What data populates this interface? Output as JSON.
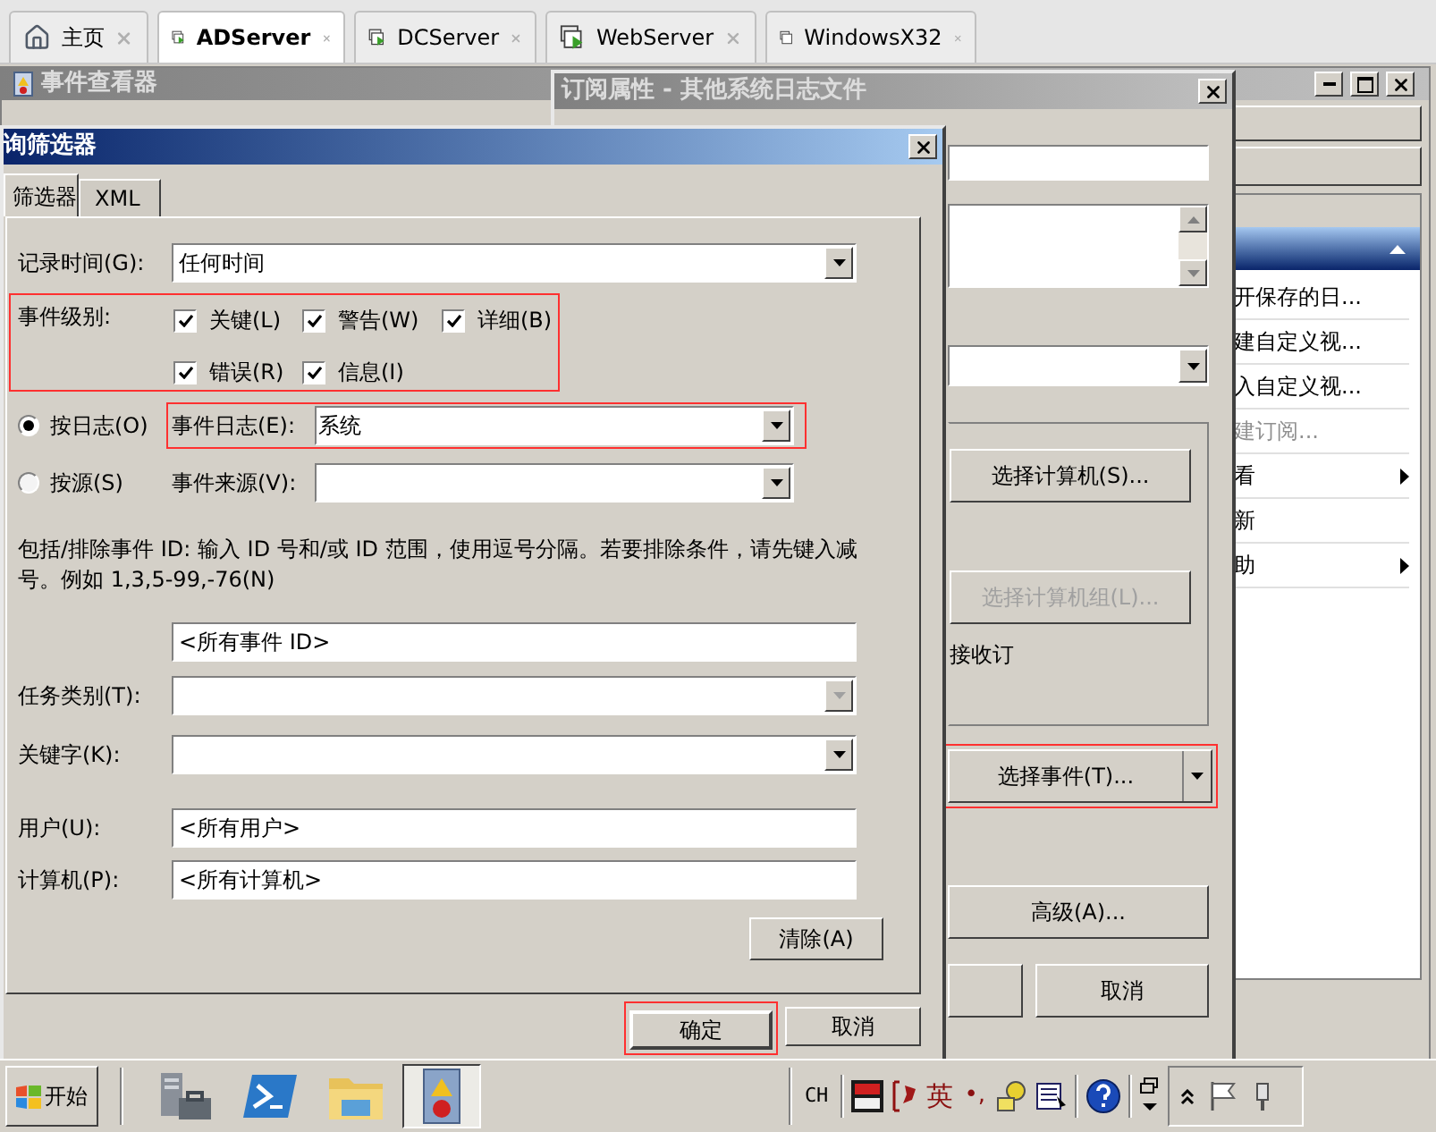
{
  "browser_tabs": [
    {
      "label": "主页",
      "kind": "home",
      "selected": false
    },
    {
      "label": "ADServer",
      "kind": "running",
      "selected": true
    },
    {
      "label": "DCServer",
      "kind": "running",
      "selected": false
    },
    {
      "label": "WebServer",
      "kind": "running",
      "selected": false
    },
    {
      "label": "WindowsX32",
      "kind": "stopped",
      "selected": false
    }
  ],
  "event_viewer": {
    "title": "事件查看器",
    "actions": [
      {
        "label": "开保存的日...",
        "disabled": false,
        "submenu": false
      },
      {
        "label": "建自定义视...",
        "disabled": false,
        "submenu": false
      },
      {
        "label": "入自定义视...",
        "disabled": false,
        "submenu": false
      },
      {
        "label": "建订阅...",
        "disabled": true,
        "submenu": false
      },
      {
        "label": "看",
        "disabled": false,
        "submenu": true
      },
      {
        "label": "新",
        "disabled": false,
        "submenu": false
      },
      {
        "label": "助",
        "disabled": false,
        "submenu": true
      }
    ]
  },
  "subscription_dialog": {
    "title": "订阅属性 - 其他系统日志文件",
    "select_computers_button": {
      "label": "选择计算机(S)...",
      "disabled": false
    },
    "select_group_button": {
      "label": "选择计算机组(L)...",
      "disabled": true
    },
    "receive_text": "接收订",
    "select_events_button": {
      "label": "选择事件(T)...",
      "highlighted": true
    },
    "advanced_button": "高级(A)...",
    "cancel_button": "取消"
  },
  "filter_dialog": {
    "title": "询筛选器",
    "tabs": [
      {
        "label": "筛选器",
        "selected": true
      },
      {
        "label": "XML",
        "selected": false
      }
    ],
    "logged": {
      "label": "记录时间(G):",
      "value": "任何时间"
    },
    "event_level": {
      "label": "事件级别:",
      "highlighted": true,
      "levels": [
        {
          "label": "关键(L)",
          "checked": true
        },
        {
          "label": "警告(W)",
          "checked": true
        },
        {
          "label": "详细(B)",
          "checked": true
        },
        {
          "label": "错误(R)",
          "checked": true
        },
        {
          "label": "信息(I)",
          "checked": true
        }
      ]
    },
    "scope": [
      {
        "label": "按日志(O)",
        "selected": true,
        "field_label": "事件日志(E):",
        "value": "系统",
        "highlighted": true
      },
      {
        "label": "按源(S)",
        "selected": false,
        "field_label": "事件来源(V):",
        "highlighted": false
      }
    ],
    "id_description": "包括/排除事件 ID: 输入 ID 号和/或 ID 范围，使用逗号分隔。若要排除条件，请先键入减号。例如 1,3,5-99,-76(N)",
    "event_ids": "<所有事件 ID>",
    "task_category": {
      "label": "任务类别(T):",
      "disabled": true
    },
    "keywords": {
      "label": "关键字(K):",
      "disabled": false
    },
    "user": {
      "label": "用户(U):",
      "value": "<所有用户>"
    },
    "computer": {
      "label": "计算机(P):",
      "value": "<所有计算机>"
    },
    "clear_button": "清除(A)",
    "ok_button": {
      "label": "确定",
      "highlighted": true
    },
    "cancel_button": "取消"
  },
  "taskbar": {
    "start_label": "开始",
    "apps": [
      {
        "kind": "server-manager",
        "active": false
      },
      {
        "kind": "powershell",
        "active": false
      },
      {
        "kind": "explorer",
        "active": false
      },
      {
        "kind": "event-viewer",
        "active": true
      }
    ],
    "tray": {
      "language": "CH",
      "ime_mode": "英",
      "punctuation": "•,"
    }
  }
}
